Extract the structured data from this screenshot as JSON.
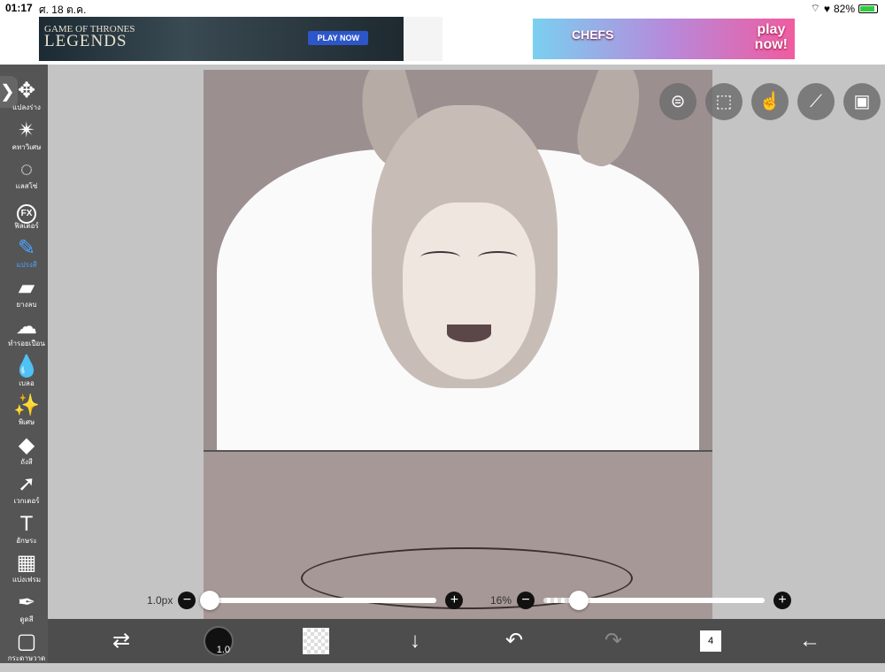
{
  "status_bar": {
    "time": "01:17",
    "date": "ศ. 18 ต.ค.",
    "battery": "82%"
  },
  "ads": {
    "left": {
      "logo_top": "GAME OF THRONES",
      "logo_bottom": "LEGENDS",
      "cta": "PLAY NOW"
    },
    "right": {
      "logo": "CHEFS",
      "cta_top": "play",
      "cta_bottom": "now!"
    }
  },
  "left_toolbar": {
    "expand": "❯",
    "tools": [
      {
        "name": "transform",
        "label": "แปลงร่าง",
        "icon": "move-icon"
      },
      {
        "name": "magic-wand",
        "label": "คทาวิเศษ",
        "icon": "magic-wand-icon"
      },
      {
        "name": "lasso",
        "label": "แลสโซ่",
        "icon": "lasso-icon"
      },
      {
        "name": "filter",
        "label": "ฟิลเตอร์",
        "icon": "fx-icon"
      },
      {
        "name": "brush",
        "label": "แปรงสี",
        "icon": "brush-icon"
      },
      {
        "name": "eraser",
        "label": "ยางลบ",
        "icon": "eraser-icon"
      },
      {
        "name": "smudge",
        "label": "ทำรอยเปื้อน",
        "icon": "smudge-icon"
      },
      {
        "name": "blur",
        "label": "เบลอ",
        "icon": "blur-drop-icon"
      },
      {
        "name": "special",
        "label": "พิเศษ",
        "icon": "sparkle-wand-icon"
      },
      {
        "name": "fill",
        "label": "ถังสี",
        "icon": "paint-bucket-icon"
      },
      {
        "name": "vector",
        "label": "เวกเตอร์",
        "icon": "cursor-icon"
      },
      {
        "name": "text",
        "label": "อักษระ",
        "icon": "text-icon"
      },
      {
        "name": "frame",
        "label": "แบ่งเฟรม",
        "icon": "frame-divide-icon"
      },
      {
        "name": "eyedropper",
        "label": "ดูดสี",
        "icon": "eyedropper-icon"
      },
      {
        "name": "canvas",
        "label": "กระดาษวาด",
        "icon": "canvas-icon"
      }
    ],
    "active_tool": "brush"
  },
  "top_icons": [
    "toggle-icon",
    "selection-icon",
    "touch-hand-icon",
    "ruler-icon",
    "image-icon"
  ],
  "brush_size": {
    "value": "1.0px",
    "level": 0.02
  },
  "opacity": {
    "value": "16%",
    "level": 0.16
  },
  "bottom_bar": {
    "brush_size_label": "1.0",
    "layer_count": "4"
  }
}
